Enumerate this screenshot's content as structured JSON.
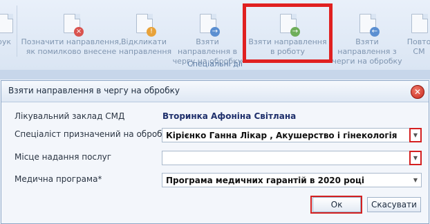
{
  "ribbon": {
    "buttons": [
      {
        "label": "рук",
        "icon": "printer-icon"
      },
      {
        "label": "Позначити направлення, як помилково внесене",
        "icon": "mark-error-icon"
      },
      {
        "label": "Відкликати направлення",
        "icon": "revoke-icon"
      },
      {
        "label": "Взяти направлення в чергу на обробку",
        "icon": "queue-arrow-icon"
      },
      {
        "label": "Взяти направлення в роботу",
        "icon": "take-to-work-icon"
      },
      {
        "label": "Взяти направлення з черги на обробку",
        "icon": "from-queue-icon"
      },
      {
        "label": "Повто СМ",
        "icon": "repeat-icon"
      }
    ],
    "group_label": "Спеціальні дії"
  },
  "dialog": {
    "title": "Взяти направлення в чергу на обробку",
    "close_glyph": "✕",
    "fields": {
      "facility_label": "Лікувальний заклад СМД",
      "facility_value": "Вторинка Афоніна Світлана",
      "specialist_label": "Спеціаліст призначений на обробку*",
      "specialist_value": "Кірієнко Ганна Лікар , Акушерство і гінекологія",
      "place_label": "Місце надання послуг",
      "place_value": "",
      "program_label": "Медична програма*",
      "program_value": "Програма медичних гарантій в 2020 році"
    },
    "ok_label": "Ок",
    "cancel_label": "Скасувати"
  },
  "colors": {
    "highlight": "#e02020",
    "accent": "#1e2f6b"
  }
}
